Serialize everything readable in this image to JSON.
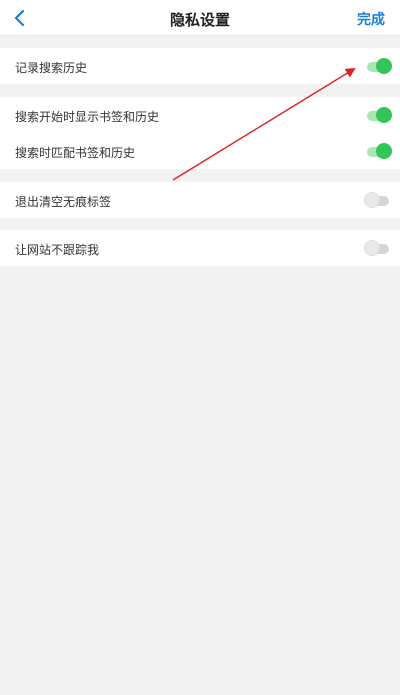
{
  "header": {
    "title": "隐私设置",
    "done_label": "完成",
    "back_icon": "chevron-left-icon"
  },
  "settings": {
    "record_history": {
      "label": "记录搜索历史",
      "enabled": true
    },
    "show_bookmarks_on_start": {
      "label": "搜索开始时显示书签和历史",
      "enabled": true
    },
    "match_bookmarks": {
      "label": "搜索时匹配书签和历史",
      "enabled": true
    },
    "clear_incognito_on_exit": {
      "label": "退出清空无痕标签",
      "enabled": false
    },
    "do_not_track": {
      "label": "让网站不跟踪我",
      "enabled": false
    }
  },
  "colors": {
    "accent": "#1a7fd8",
    "toggle_on": "#31c55a",
    "annotation_arrow": "#e02020"
  }
}
